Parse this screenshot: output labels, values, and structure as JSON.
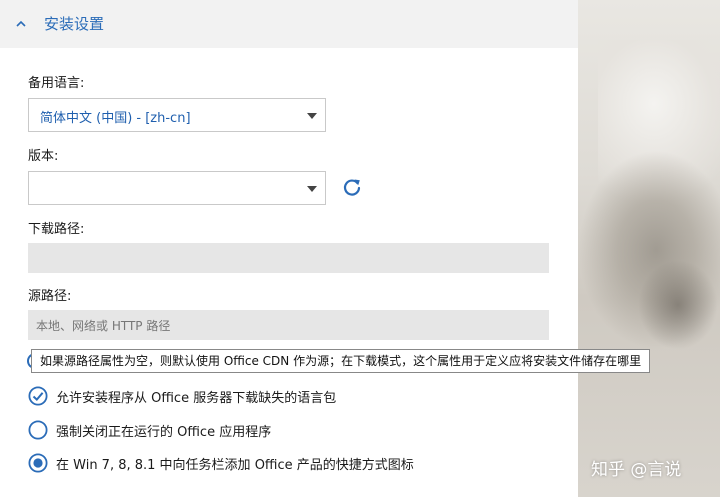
{
  "section": {
    "title": "安装设置"
  },
  "language": {
    "label": "备用语言:",
    "selected": "简体中文 (中国) - [zh-cn]"
  },
  "edition": {
    "label": "版本:",
    "selected": ""
  },
  "download_path": {
    "label": "下载路径:",
    "value": ""
  },
  "source_path": {
    "label": "源路径:",
    "placeholder": "本地、网络或 HTTP 路径"
  },
  "tooltip": {
    "text": "如果源路径属性为空，则默认使用 Office CDN 作为源；在下载模式，这个属性用于定义应将安装文件储存在哪里"
  },
  "options": {
    "allow_download_lang": {
      "label": "允许安装程序从 Office 服务器下载缺失的语言包",
      "checked": true
    },
    "force_close_apps": {
      "label": "强制关闭正在运行的 Office 应用程序",
      "checked": false
    },
    "pin_taskbar": {
      "label": "在 Win 7, 8, 8.1 中向任务栏添加 Office 产品的快捷方式图标",
      "checked": true
    }
  },
  "watermark": {
    "text": "知乎 @言说"
  },
  "colors": {
    "accent": "#2b6cb8",
    "field_bg": "#e6e6e6",
    "header_bg": "#f2f2f2"
  }
}
